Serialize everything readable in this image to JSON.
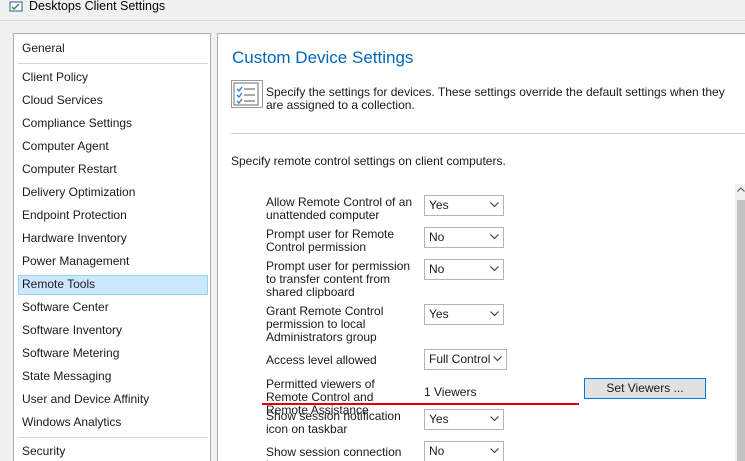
{
  "window": {
    "title": "Desktops Client Settings"
  },
  "nav": {
    "items": [
      {
        "label": "General"
      },
      {
        "label": "Client Policy"
      },
      {
        "label": "Cloud Services"
      },
      {
        "label": "Compliance Settings"
      },
      {
        "label": "Computer Agent"
      },
      {
        "label": "Computer Restart"
      },
      {
        "label": "Delivery Optimization"
      },
      {
        "label": "Endpoint Protection"
      },
      {
        "label": "Hardware Inventory"
      },
      {
        "label": "Power Management"
      },
      {
        "label": "Remote Tools",
        "selected": true
      },
      {
        "label": "Software Center"
      },
      {
        "label": "Software Inventory"
      },
      {
        "label": "Software Metering"
      },
      {
        "label": "State Messaging"
      },
      {
        "label": "User and Device Affinity"
      },
      {
        "label": "Windows Analytics"
      },
      {
        "label": "Security"
      }
    ]
  },
  "panel": {
    "title": "Custom Device Settings",
    "description": "Specify the settings for devices. These settings override the default settings when they are assigned to a collection.",
    "subheading": "Specify remote control settings on client computers.",
    "settings": [
      {
        "label": "Allow Remote Control of an unattended computer",
        "value": "Yes"
      },
      {
        "label": "Prompt user for Remote Control permission",
        "value": "No"
      },
      {
        "label": "Prompt user for permission to transfer content from shared clipboard",
        "value": "No"
      },
      {
        "label": "Grant Remote Control permission to local Administrators group",
        "value": "Yes"
      },
      {
        "label": "Access level allowed",
        "value": "Full Control"
      },
      {
        "label": "Show session notification icon on taskbar",
        "value": "Yes"
      },
      {
        "label": "Show session connection bar",
        "value": "No"
      }
    ],
    "viewers": {
      "label": "Permitted viewers of Remote Control and Remote Assistance",
      "value": "1 Viewers",
      "button_label": "Set Viewers ..."
    }
  },
  "colors": {
    "accent_title": "#0067b8",
    "selection_bg": "#cce8ff",
    "highlight_underline": "#e00000"
  }
}
